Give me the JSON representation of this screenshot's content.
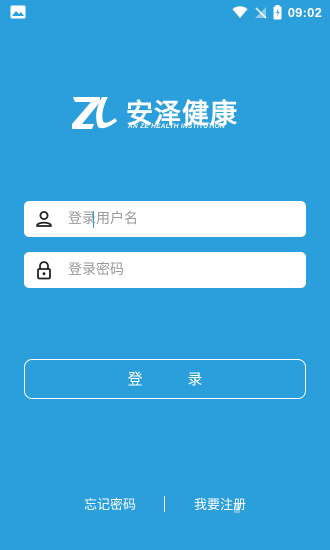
{
  "status_bar": {
    "time": "09:02",
    "icons": [
      "image-icon",
      "wifi-icon",
      "no-signal-icon",
      "battery-icon"
    ]
  },
  "logo": {
    "title": "安泽健康",
    "subtitle": "AN ZE HEALTH INSTITUTION"
  },
  "login_form": {
    "username": {
      "placeholder": "登录用户名",
      "value": "",
      "icon": "person-icon"
    },
    "password": {
      "placeholder": "登录密码",
      "value": "",
      "icon": "lock-icon"
    },
    "submit_label": "登 录"
  },
  "footer": {
    "forgot_password": "忘记密码",
    "divider": "|",
    "register": "我要注册"
  },
  "colors": {
    "background": "#2a9fdb",
    "field_background": "#ffffff",
    "text": "#ffffff",
    "placeholder": "#9a9a9a"
  }
}
